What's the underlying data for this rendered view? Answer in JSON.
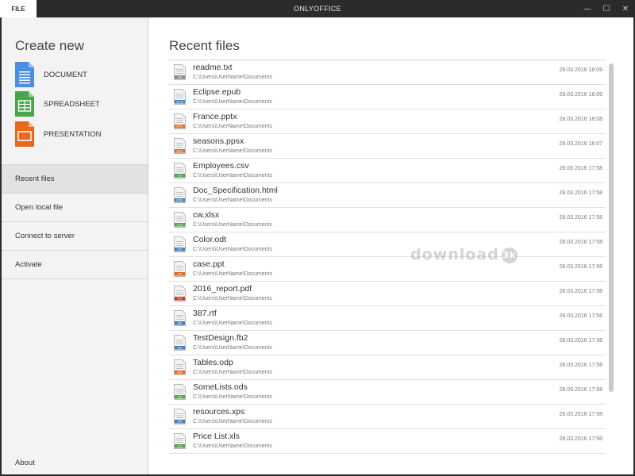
{
  "titlebar": {
    "file_tab": "FILE",
    "title": "ONLYOFFICE",
    "minimize": "—",
    "maximize": "☐",
    "close": "✕"
  },
  "sidebar": {
    "create_title": "Create new",
    "create_items": [
      {
        "label": "DOCUMENT",
        "icon": "document-icon",
        "color": "#4a90e2"
      },
      {
        "label": "SPREADSHEET",
        "icon": "spreadsheet-icon",
        "color": "#49a54a"
      },
      {
        "label": "PRESENTATION",
        "icon": "presentation-icon",
        "color": "#e8681f"
      }
    ],
    "nav": [
      {
        "label": "Recent files",
        "active": true
      },
      {
        "label": "Open local file",
        "active": false
      },
      {
        "label": "Connect to server",
        "active": false
      },
      {
        "label": "Activate",
        "active": false
      }
    ],
    "about": "About"
  },
  "main": {
    "title": "Recent files",
    "files": [
      {
        "name": "readme.txt",
        "path": "C:\\Users\\UserName\\Documents",
        "date": "28.03.2016 18:09",
        "type": "TXT",
        "color": "#8a8a8a"
      },
      {
        "name": "Eclipse.epub",
        "path": "C:\\Users\\UserName\\Documents",
        "date": "28.03.2016 18:09",
        "type": "EPUB",
        "color": "#3d7fc6"
      },
      {
        "name": "France.pptx",
        "path": "C:\\Users\\UserName\\Documents",
        "date": "28.03.2016 18:08",
        "type": "PPTX",
        "color": "#e8681f"
      },
      {
        "name": "seasons.ppsx",
        "path": "C:\\Users\\UserName\\Documents",
        "date": "28.03.2016 18:07",
        "type": "PPSX",
        "color": "#e8681f"
      },
      {
        "name": "Employees.csv",
        "path": "C:\\Users\\UserName\\Documents",
        "date": "28.03.2016 17:58",
        "type": "CSV",
        "color": "#49a54a"
      },
      {
        "name": "Doc_Specification.html",
        "path": "C:\\Users\\UserName\\Documents",
        "date": "28.03.2016 17:58",
        "type": "HTML",
        "color": "#3d7fc6"
      },
      {
        "name": "cw.xlsx",
        "path": "C:\\Users\\UserName\\Documents",
        "date": "28.03.2016 17:58",
        "type": "XLSX",
        "color": "#49a54a"
      },
      {
        "name": "Color.odt",
        "path": "C:\\Users\\UserName\\Documents",
        "date": "28.03.2016 17:58",
        "type": "ODT",
        "color": "#3d7fc6"
      },
      {
        "name": "case.ppt",
        "path": "C:\\Users\\UserName\\Documents",
        "date": "28.03.2016 17:58",
        "type": "PPT",
        "color": "#e8681f"
      },
      {
        "name": "2016_report.pdf",
        "path": "C:\\Users\\UserName\\Documents",
        "date": "28.03.2016 17:58",
        "type": "PDF",
        "color": "#c73a2e"
      },
      {
        "name": "387.rtf",
        "path": "C:\\Users\\UserName\\Documents",
        "date": "28.03.2016 17:58",
        "type": "RTF",
        "color": "#3d7fc6"
      },
      {
        "name": "TestDesign.fb2",
        "path": "C:\\Users\\UserName\\Documents",
        "date": "28.03.2016 17:58",
        "type": "FB2",
        "color": "#3d7fc6"
      },
      {
        "name": "Tables.odp",
        "path": "C:\\Users\\UserName\\Documents",
        "date": "28.03.2016 17:58",
        "type": "ODP",
        "color": "#e8681f"
      },
      {
        "name": "SomeLists.ods",
        "path": "C:\\Users\\UserName\\Documents",
        "date": "28.03.2016 17:58",
        "type": "ODS",
        "color": "#49a54a"
      },
      {
        "name": "resources.xps",
        "path": "C:\\Users\\UserName\\Documents",
        "date": "28.03.2016 17:58",
        "type": "XPS",
        "color": "#3d7fc6"
      },
      {
        "name": "Price List.xls",
        "path": "C:\\Users\\UserName\\Documents",
        "date": "28.03.2016 17:58",
        "type": "XLS",
        "color": "#49a54a"
      }
    ]
  },
  "watermark": {
    "text": "download",
    "badge": "3k"
  }
}
